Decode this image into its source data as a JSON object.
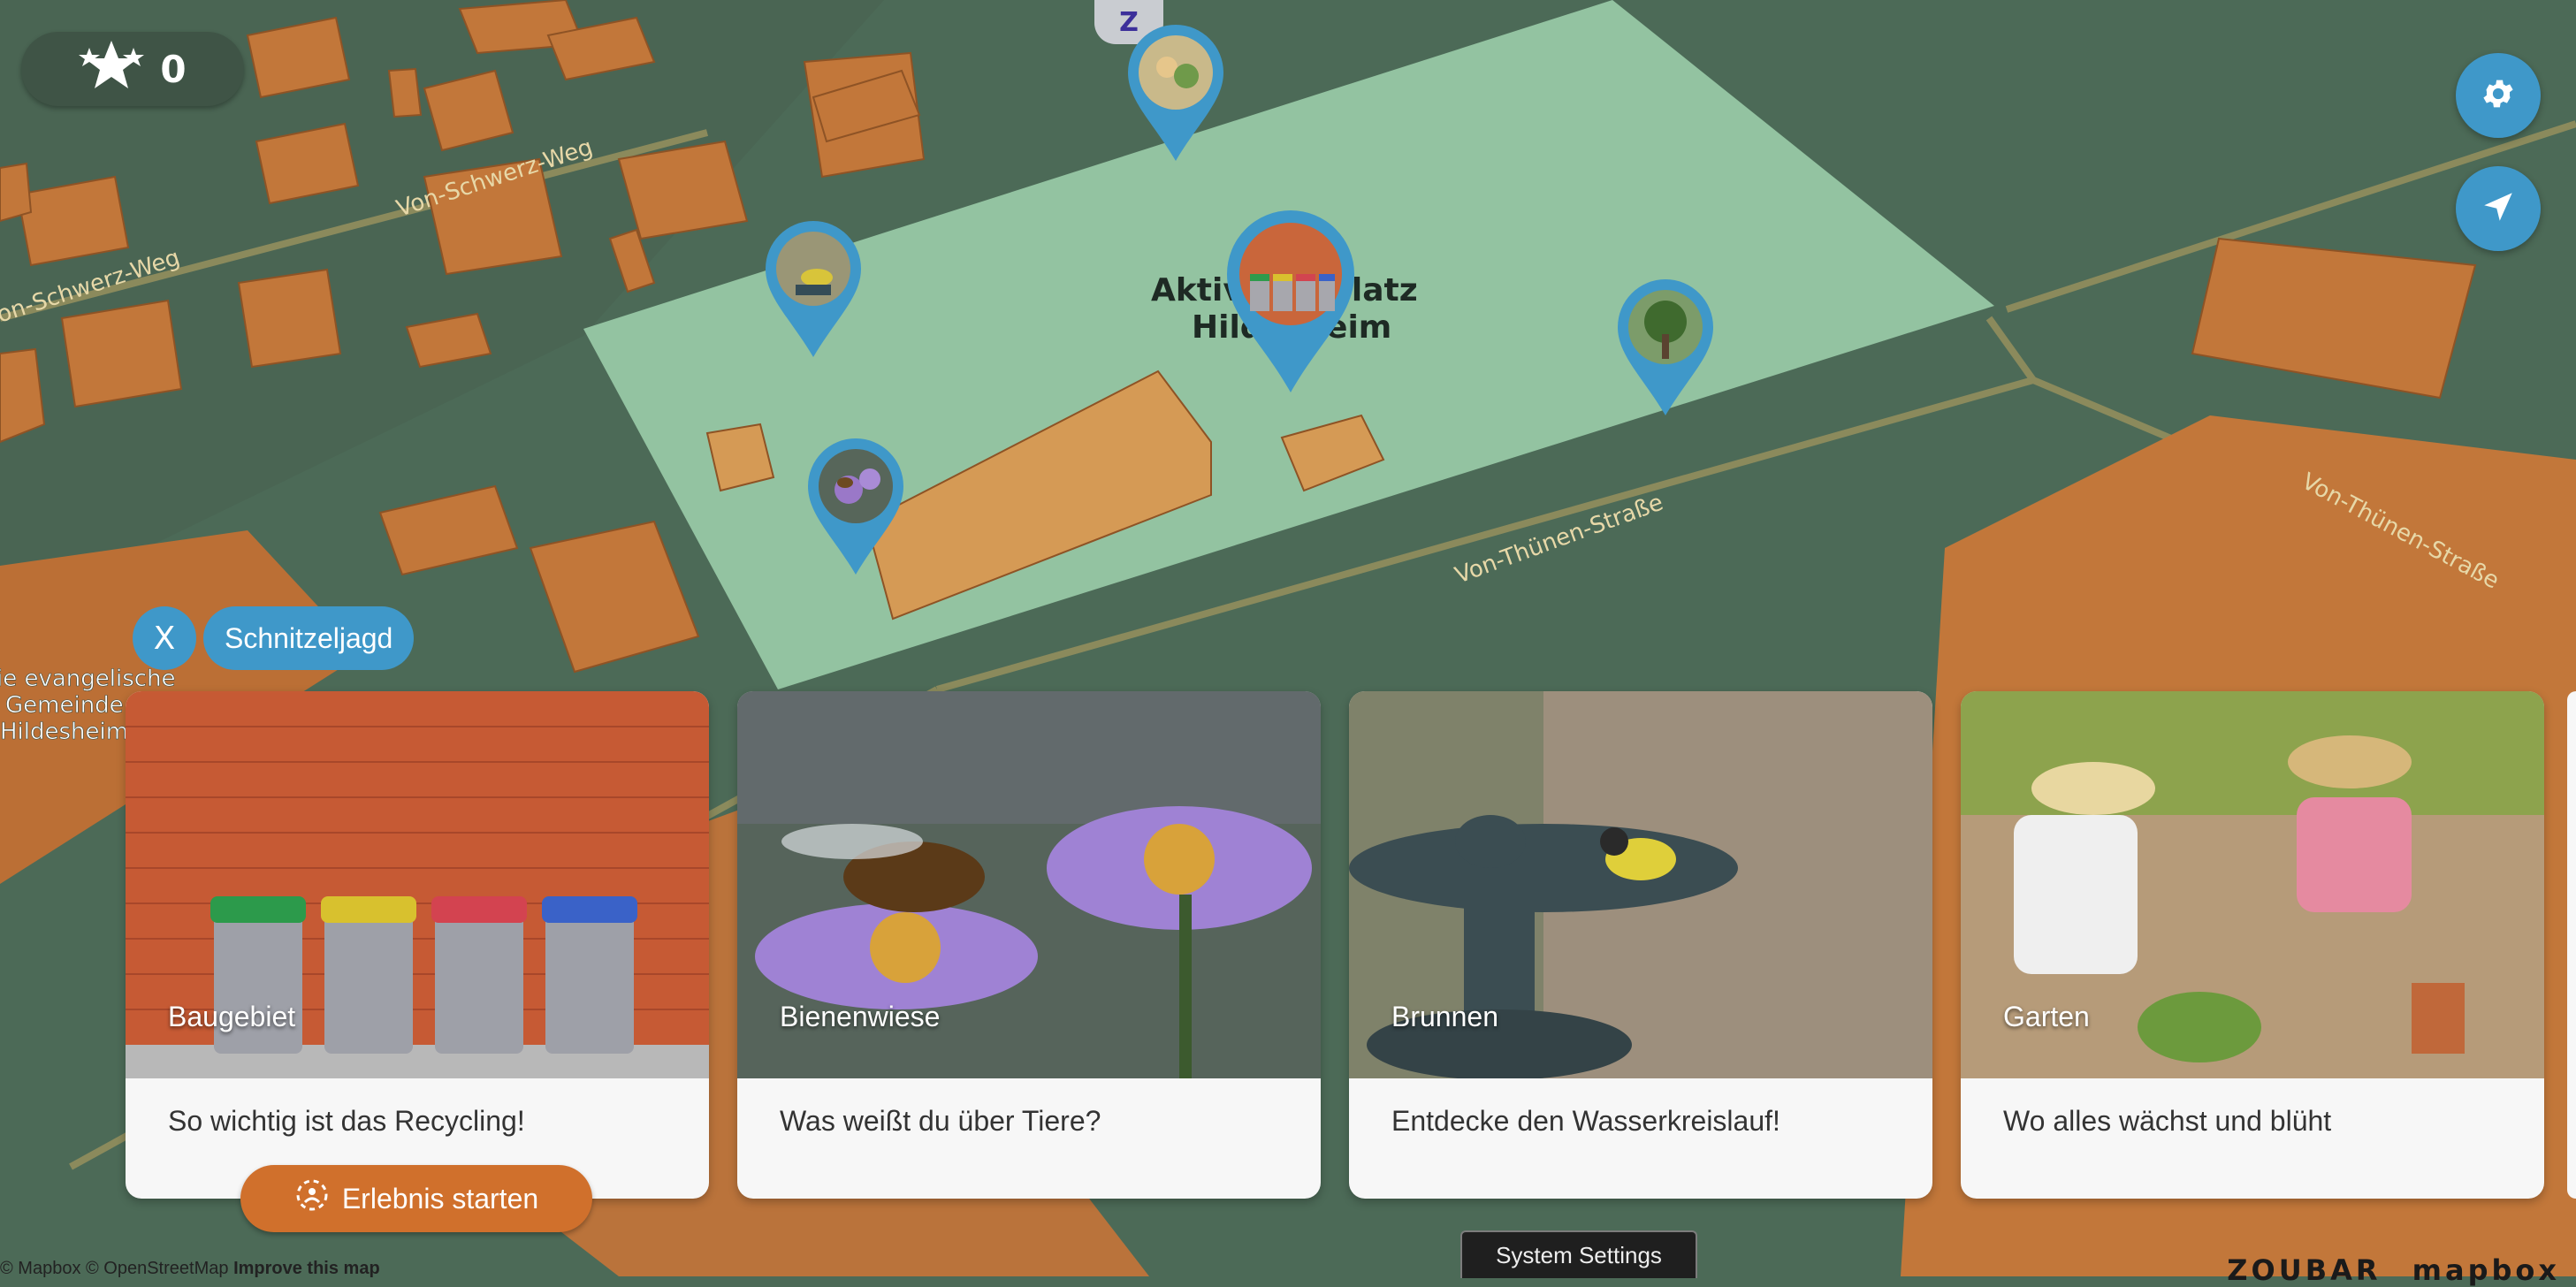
{
  "score": {
    "value": "0",
    "icon": "stars-icon"
  },
  "top_tab": {
    "icon": "zoubar-logo-icon",
    "label": "Z"
  },
  "map": {
    "streets": [
      "Von-Schwerz-Weg",
      "Von-Schwerz-Weg",
      "Von-Thünen-Straße",
      "Von-Thünen-Straße"
    ],
    "place_label_line1": "Aktivspielplatz",
    "place_label_line2": "Hildesheim",
    "church_label": [
      "ie evangelische",
      "Gemeinde",
      "Hildesheim"
    ],
    "colors": {
      "ground": "#4c6a57",
      "park": "#93c3a1",
      "building": "#c2773a",
      "road": "#8b8a5c"
    }
  },
  "buttons": {
    "settings_icon": "gear-icon",
    "locate_icon": "navigation-arrow-icon"
  },
  "filter": {
    "close_label": "X",
    "chip_label": "Schnitzeljagd"
  },
  "cards": [
    {
      "title": "Baugebiet",
      "subtitle": "So wichtig ist das Recycling!"
    },
    {
      "title": "Bienenwiese",
      "subtitle": "Was weißt du über Tiere?"
    },
    {
      "title": "Brunnen",
      "subtitle": "Entdecke den Wasserkreislauf!"
    },
    {
      "title": "Garten",
      "subtitle": "Wo alles wächst und blüht"
    }
  ],
  "start_button": {
    "label": "Erlebnis starten",
    "icon": "scan-icon"
  },
  "system_settings": "System Settings",
  "attribution": {
    "text": "© Mapbox © OpenStreetMap",
    "link": "Improve this map"
  },
  "logos": {
    "zoubar": "ZOUBAR",
    "mapbox": "mapbox"
  }
}
